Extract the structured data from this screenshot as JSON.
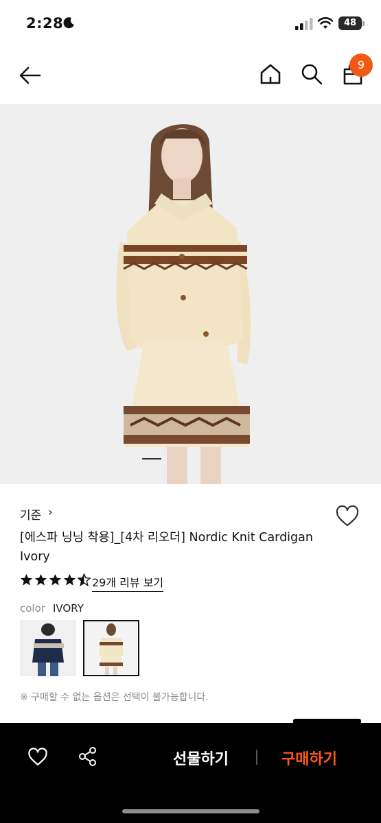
{
  "status_bar": {
    "time": "2:28",
    "battery": "48"
  },
  "header": {
    "cart_count": "9"
  },
  "product": {
    "brand": "기준",
    "brand_chevron": "›",
    "title": "[에스파 닝닝 착용]_[4차 리오더] Nordic Knit Cardigan Ivory",
    "rating": 4.5,
    "review_link": "29개 리뷰 보기",
    "color_label": "color",
    "color_value": "IVORY",
    "notice": "※ 구매할 수 없는 옵션은 선택이 불가능합니다."
  },
  "bottom_bar": {
    "gift_label": "선물하기",
    "buy_label": "구매하기"
  },
  "colors": {
    "accent": "#f05a16",
    "buy_text": "#ff5a1a",
    "bottom_bg": "#000000"
  }
}
